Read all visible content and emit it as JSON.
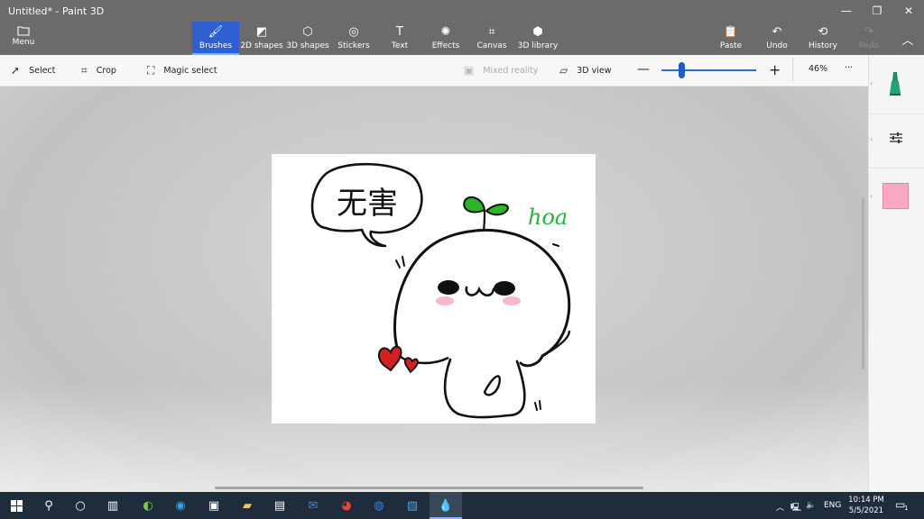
{
  "window": {
    "title": "Untitled* - Paint 3D",
    "minimize_glyph": "—",
    "restore_glyph": "❐",
    "close_glyph": "✕"
  },
  "ribbon": {
    "menu_label": "Menu",
    "tabs": [
      {
        "label": "Brushes",
        "icon": "brush-icon",
        "active": true
      },
      {
        "label": "2D shapes",
        "icon": "2d-shapes-icon"
      },
      {
        "label": "3D shapes",
        "icon": "3d-shapes-icon"
      },
      {
        "label": "Stickers",
        "icon": "stickers-icon"
      },
      {
        "label": "Text",
        "icon": "text-icon"
      },
      {
        "label": "Effects",
        "icon": "effects-icon"
      },
      {
        "label": "Canvas",
        "icon": "canvas-icon"
      },
      {
        "label": "3D library",
        "icon": "3d-library-icon"
      }
    ],
    "paste_label": "Paste",
    "undo_label": "Undo",
    "history_label": "History",
    "redo_label": "Redo",
    "accent": "#2f5fd0"
  },
  "toolbar": {
    "select_label": "Select",
    "crop_label": "Crop",
    "magic_select_label": "Magic select",
    "mixed_reality_label": "Mixed reality",
    "view_3d_label": "3D view",
    "zoom_value": "46%",
    "more_glyph": "···"
  },
  "canvas": {
    "speech_text": "无害",
    "signature": "hoa",
    "colors": {
      "sprout": "#2bb52b",
      "signature": "#21b53a",
      "hearts": "#d42020",
      "blush": "#f6b8c8"
    }
  },
  "side_panel": {
    "selected_color": "#f8a8c4"
  },
  "taskbar": {
    "language": "ENG",
    "time": "10:14 PM",
    "date": "5/5/2021",
    "notification_count": "1"
  }
}
